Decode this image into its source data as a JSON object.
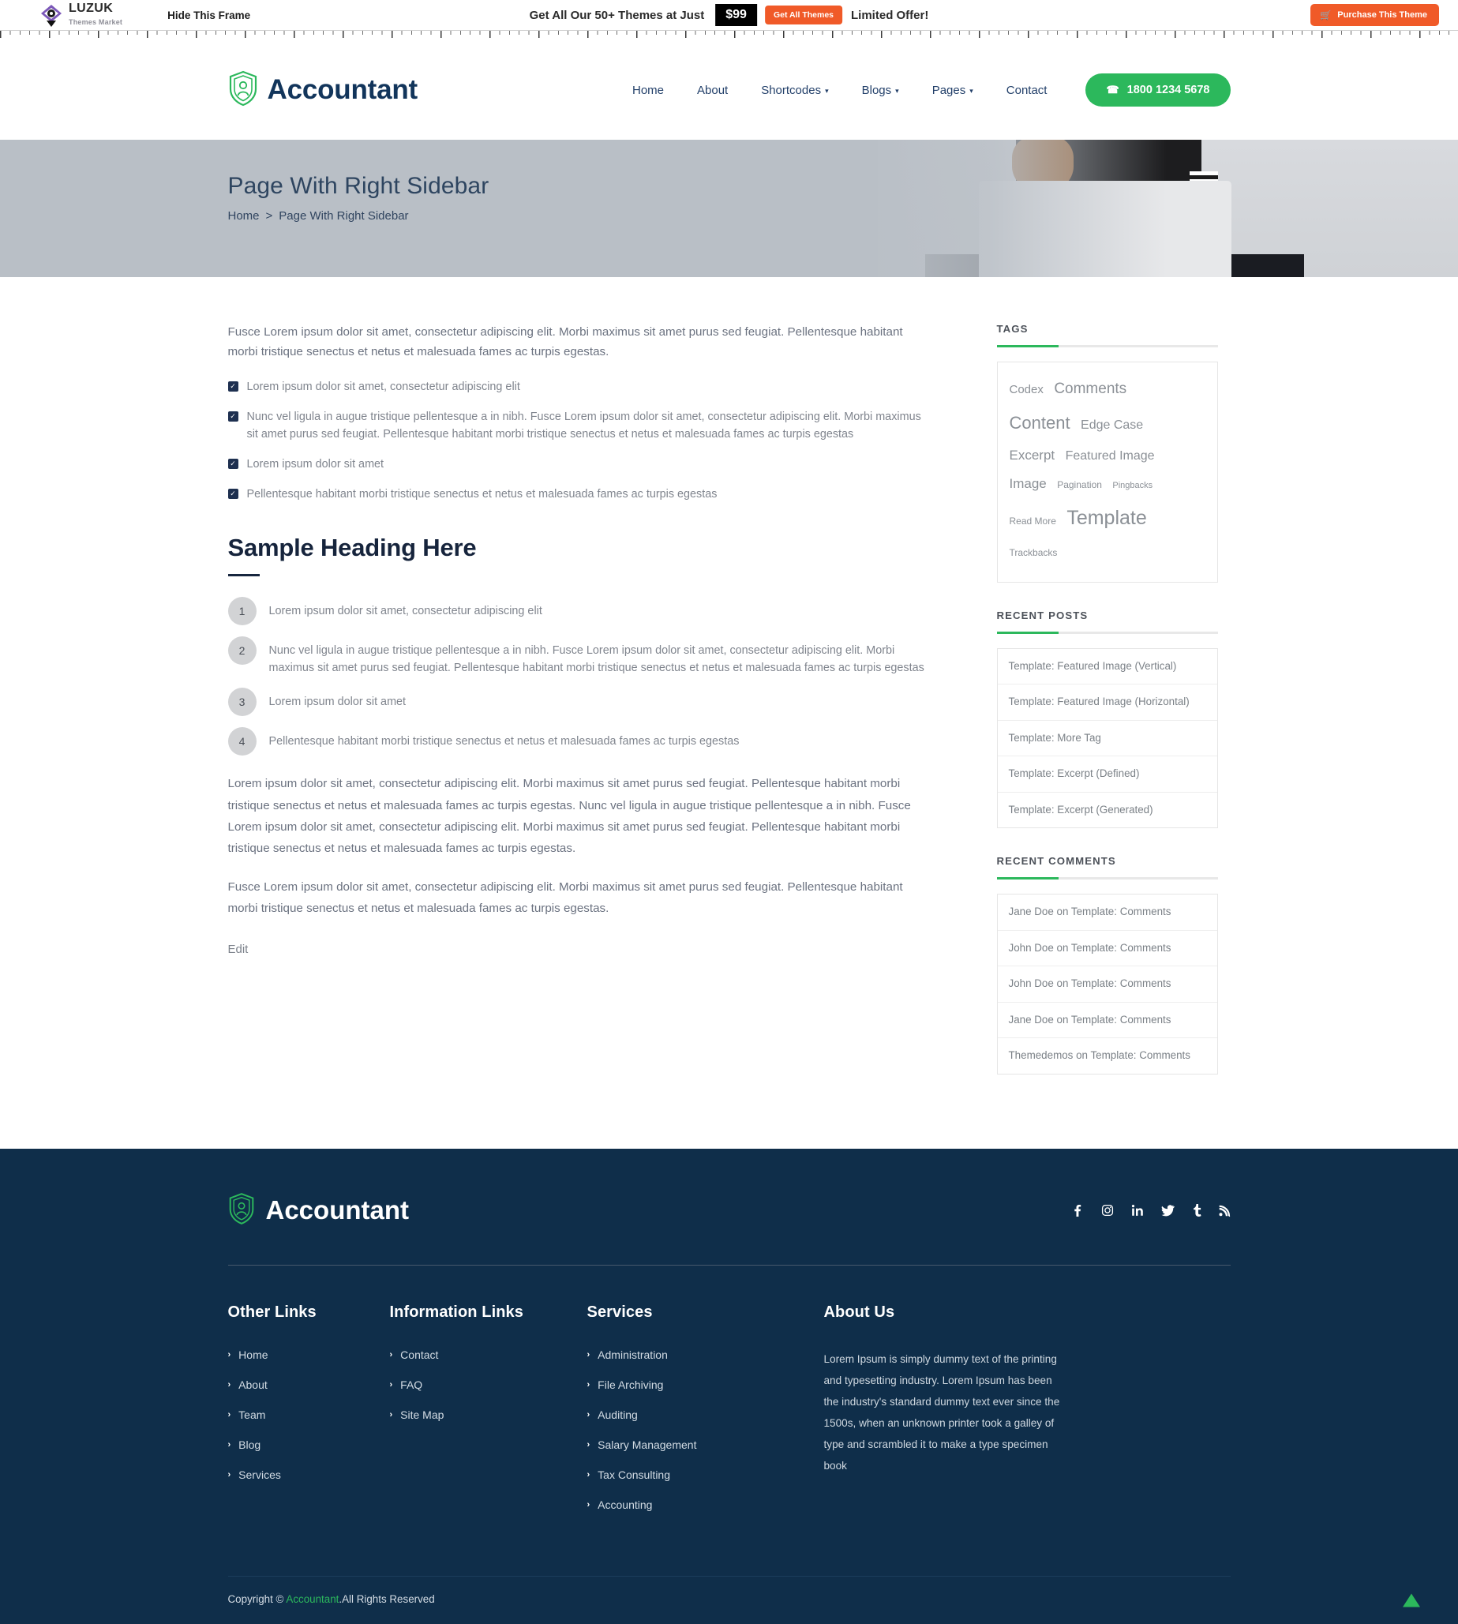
{
  "promo": {
    "logo_name": "LUZUK",
    "logo_sub": "Themes Market",
    "hide_frame": "Hide This Frame",
    "headline": "Get All Our 50+ Themes at Just",
    "price": "$99",
    "cta": "Get All Themes",
    "limited": "Limited Offer!",
    "purchase": "Purchase This Theme"
  },
  "header": {
    "brand": "Accountant",
    "nav": [
      {
        "label": "Home",
        "has_caret": false
      },
      {
        "label": "About",
        "has_caret": false
      },
      {
        "label": "Shortcodes",
        "has_caret": true
      },
      {
        "label": "Blogs",
        "has_caret": true
      },
      {
        "label": "Pages",
        "has_caret": true
      },
      {
        "label": "Contact",
        "has_caret": false
      }
    ],
    "phone": "1800 1234 5678"
  },
  "hero": {
    "title": "Page With Right Sidebar",
    "crumb_home": "Home",
    "crumb_sep": ">",
    "crumb_current": "Page With Right Sidebar"
  },
  "main": {
    "lead": "Fusce Lorem ipsum dolor sit amet, consectetur adipiscing elit. Morbi maximus sit amet purus sed feugiat. Pellentesque habitant morbi tristique senectus et netus et malesuada fames ac turpis egestas.",
    "check_items": [
      "Lorem ipsum dolor sit amet, consectetur adipiscing elit",
      "Nunc vel ligula in augue tristique pellentesque a in nibh. Fusce Lorem ipsum dolor sit amet, consectetur adipiscing elit. Morbi maximus sit amet purus sed feugiat. Pellentesque habitant morbi tristique senectus et netus et malesuada fames ac turpis egestas",
      "Lorem ipsum dolor sit amet",
      "Pellentesque habitant morbi tristique senectus et netus et malesuada fames ac turpis egestas"
    ],
    "heading": "Sample Heading Here",
    "numbered_items": [
      {
        "num": "1",
        "text": "Lorem ipsum dolor sit amet, consectetur adipiscing elit"
      },
      {
        "num": "2",
        "text": "Nunc vel ligula in augue tristique pellentesque a in nibh. Fusce Lorem ipsum dolor sit amet, consectetur adipiscing elit. Morbi maximus sit amet purus sed feugiat. Pellentesque habitant morbi tristique senectus et netus et malesuada fames ac turpis egestas"
      },
      {
        "num": "3",
        "text": "Lorem ipsum dolor sit amet"
      },
      {
        "num": "4",
        "text": "Pellentesque habitant morbi tristique senectus et netus et malesuada fames ac turpis egestas"
      }
    ],
    "para1": "Lorem ipsum dolor sit amet, consectetur adipiscing elit. Morbi maximus sit amet purus sed feugiat. Pellentesque habitant morbi tristique senectus et netus et malesuada fames ac turpis egestas. Nunc vel ligula in augue tristique pellentesque a in nibh. Fusce Lorem ipsum dolor sit amet, consectetur adipiscing elit. Morbi maximus sit amet purus sed feugiat. Pellentesque habitant morbi tristique senectus et netus et malesuada fames ac turpis egestas.",
    "para2": "Fusce Lorem ipsum dolor sit amet, consectetur adipiscing elit. Morbi maximus sit amet purus sed feugiat. Pellentesque habitant morbi tristique senectus et netus et malesuada fames ac turpis egestas.",
    "edit": "Edit"
  },
  "sidebar": {
    "tags_title": "TAGS",
    "tags": [
      {
        "label": "Codex",
        "size": 15
      },
      {
        "label": "Comments",
        "size": 19
      },
      {
        "label": "Content",
        "size": 22
      },
      {
        "label": "Edge Case",
        "size": 16
      },
      {
        "label": "Excerpt",
        "size": 17
      },
      {
        "label": "Featured Image",
        "size": 16
      },
      {
        "label": "Image",
        "size": 17
      },
      {
        "label": "Pagination",
        "size": 12
      },
      {
        "label": "Pingbacks",
        "size": 11
      },
      {
        "label": "Read More",
        "size": 12
      },
      {
        "label": "Template",
        "size": 25
      },
      {
        "label": "Trackbacks",
        "size": 12
      }
    ],
    "recent_posts_title": "RECENT POSTS",
    "recent_posts": [
      "Template: Featured Image (Vertical)",
      "Template: Featured Image (Horizontal)",
      "Template: More Tag",
      "Template: Excerpt (Defined)",
      "Template: Excerpt (Generated)"
    ],
    "recent_comments_title": "RECENT COMMENTS",
    "recent_comments": [
      "Jane Doe on Template: Comments",
      "John Doe on Template: Comments",
      "John Doe on Template: Comments",
      "Jane Doe on Template: Comments",
      "Themedemos on Template: Comments"
    ]
  },
  "footer": {
    "brand": "Accountant",
    "socials": [
      {
        "name": "facebook-icon",
        "glyph": "f"
      },
      {
        "name": "instagram-icon",
        "glyph": "▢"
      },
      {
        "name": "linkedin-icon",
        "glyph": "in"
      },
      {
        "name": "twitter-icon",
        "glyph": "ᵛ"
      },
      {
        "name": "tumblr-icon",
        "glyph": "t"
      },
      {
        "name": "rss-icon",
        "glyph": "◠"
      }
    ],
    "col1_title": "Other Links",
    "col1": [
      "Home",
      "About",
      "Team",
      "Blog",
      "Services"
    ],
    "col2_title": "Information Links",
    "col2": [
      "Contact",
      "FAQ",
      "Site Map"
    ],
    "col3_title": "Services",
    "col3": [
      "Administration",
      "File Archiving",
      "Auditing",
      "Salary Management",
      "Tax Consulting",
      "Accounting"
    ],
    "col4_title": "About Us",
    "about": "Lorem Ipsum is simply dummy text of the printing and typesetting industry. Lorem Ipsum has been the industry's standard dummy text ever since the 1500s, when an unknown printer took a galley of type and scrambled it to make a type specimen book",
    "copyright_pre": "Copyright © ",
    "copyright_brand": "Accountant",
    "copyright_post": ".All Rights Reserved"
  },
  "colors": {
    "accent_green": "#2cb85c",
    "orange": "#f05a28",
    "navy": "#0f2e4a",
    "heading_navy": "#16243c"
  }
}
